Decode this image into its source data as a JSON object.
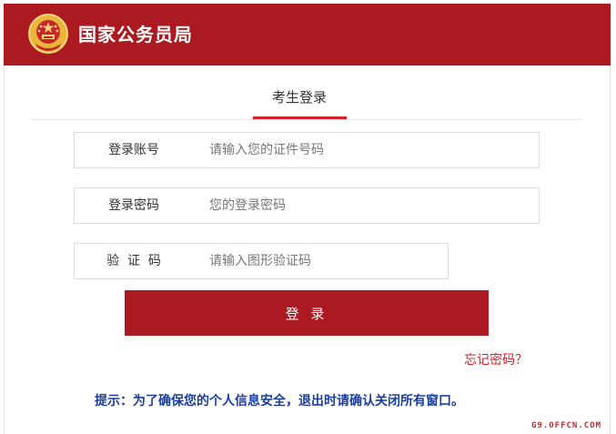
{
  "header": {
    "title": "国家公务员局",
    "color": "#ab1a20"
  },
  "tabs": [
    {
      "label": "考生登录",
      "active": true
    }
  ],
  "form": {
    "account": {
      "label": "登录账号",
      "placeholder": "请输入您的证件号码",
      "value": ""
    },
    "password": {
      "label": "登录密码",
      "placeholder": "您的登录密码",
      "value": ""
    },
    "captcha": {
      "label": "验  证  码",
      "placeholder": "请输入图形验证码",
      "value": ""
    },
    "submit_label": "登 录",
    "forgot_label": "忘记密码？"
  },
  "tip": "提示：为了确保您的个人信息安全，退出时请确认关闭所有窗口。",
  "watermark": "G9.OFFCN.COM",
  "colors": {
    "accent": "#ab1a20",
    "link": "#d3242b",
    "tip": "#1b3f9e"
  }
}
